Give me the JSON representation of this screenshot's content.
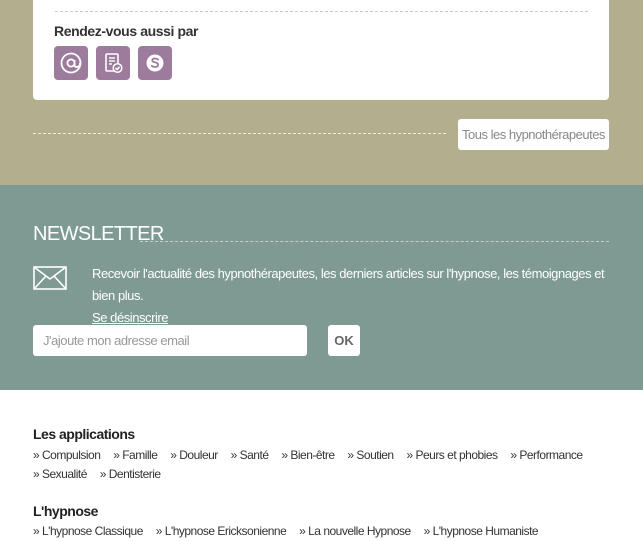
{
  "contact": {
    "title": "Rendez-vous aussi par",
    "icons": [
      "at-icon",
      "form-icon",
      "skype-icon"
    ],
    "color": "#9c7b9c"
  },
  "all_button": "Tous les hypnothérapeutes",
  "newsletter": {
    "title": "NEWSLETTER",
    "text": "Recevoir l'actualité des hypnothérapeutes, les derniers articles sur l'hypnose, les témoignages et bien plus.",
    "unsubscribe": "Se désinscrire",
    "placeholder": "J'ajoute mon adresse email",
    "ok": "OK"
  },
  "applications": {
    "title": "Les applications",
    "items": [
      "» Compulsion",
      "» Famille",
      "» Douleur",
      "» Santé",
      "» Bien-être",
      "» Soutien",
      "» Peurs et phobies",
      "» Performance",
      "» Sexualité",
      "» Dentisterie"
    ]
  },
  "hypnose": {
    "title": "L'hypnose",
    "items": [
      "» L'hypnose Classique",
      "» L'hypnose Ericksonienne",
      "» La nouvelle Hypnose",
      "» L'hypnose Humaniste"
    ]
  },
  "colors": {
    "beige": "#b3ae8e",
    "teal": "#7f9a93"
  }
}
